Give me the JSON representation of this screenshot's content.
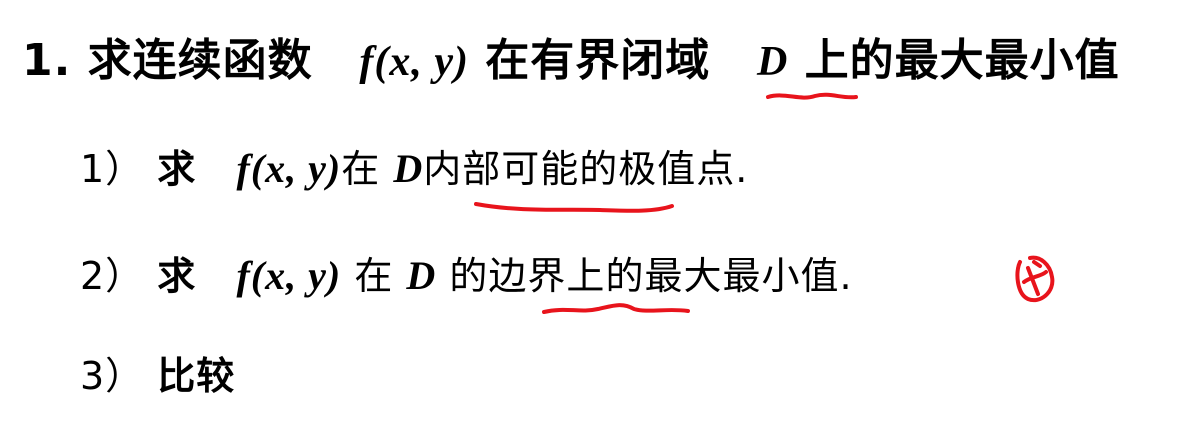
{
  "title": {
    "number": "1.",
    "prefix": "求连续函数",
    "func_f": "f",
    "func_args": "(x, y)",
    "middle": "在有界闭域",
    "domain_D": "D",
    "suffix": "上的最大最小值"
  },
  "steps": [
    {
      "num": "1）",
      "verb": "求",
      "func_f": "f",
      "func_args": "(x, y)",
      "word_in": "在",
      "domain_D": "D",
      "underlined": "内部可能",
      "rest": "的极值点."
    },
    {
      "num": "2）",
      "verb": "求",
      "func_f": "f",
      "func_args": "(x, y)",
      "word_in": "在",
      "domain_D": "D",
      "pre": "的",
      "underlined": "边界上",
      "rest": "的最大最小值."
    },
    {
      "num": "3）",
      "text": "比较"
    }
  ],
  "annotation_color": "#e8141c"
}
